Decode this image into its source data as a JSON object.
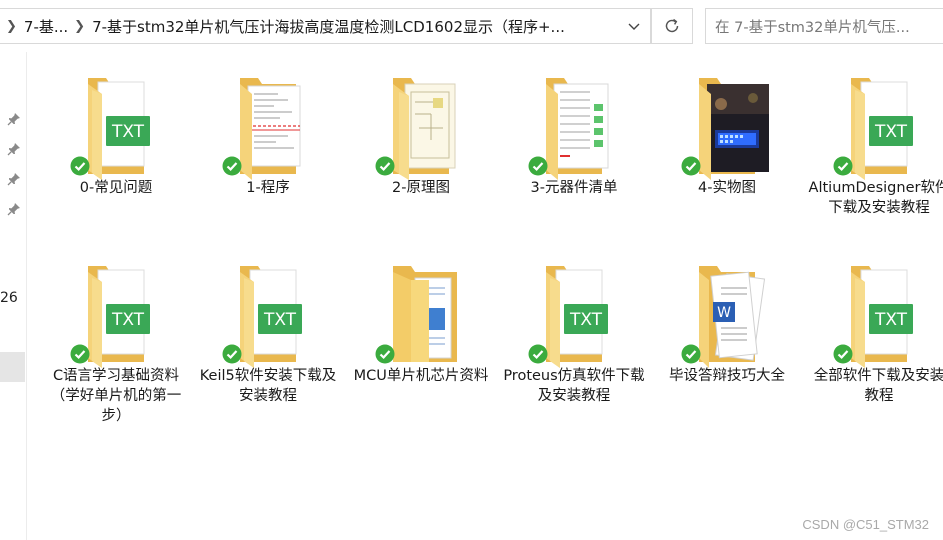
{
  "address_bar": {
    "crumbs": [
      "7-基...",
      "7-基于stm32单片机气压计海拔高度温度检测LCD1602显示（程序+..."
    ]
  },
  "search": {
    "placeholder": "在 7-基于stm32单片机气压..."
  },
  "left_pane": {
    "partial_text": "26"
  },
  "colors": {
    "folder": "#f2cb6a",
    "txt_badge": "#3aa856",
    "sync_ok": "#3bab3e"
  },
  "files": [
    {
      "label": "0-常见问题",
      "type": "txt-folder"
    },
    {
      "label": "1-程序",
      "type": "code-folder"
    },
    {
      "label": "2-原理图",
      "type": "schematic-folder"
    },
    {
      "label": "3-元器件清单",
      "type": "list-folder"
    },
    {
      "label": "4-实物图",
      "type": "photo-folder"
    },
    {
      "label": "AltiumDesigner软件下载及安装教程",
      "type": "txt-folder"
    },
    {
      "label": "C语言学习基础资料（学好单片机的第一步）",
      "type": "txt-folder"
    },
    {
      "label": "Keil5软件安装下载及安装教程",
      "type": "txt-folder"
    },
    {
      "label": "MCU单片机芯片资料",
      "type": "docs-folder"
    },
    {
      "label": "Proteus仿真软件下载及安装教程",
      "type": "txt-folder"
    },
    {
      "label": "毕设答辩技巧大全",
      "type": "word-folder"
    },
    {
      "label": "全部软件下载及安装教程",
      "type": "txt-folder"
    }
  ],
  "watermark": "CSDN @C51_STM32"
}
